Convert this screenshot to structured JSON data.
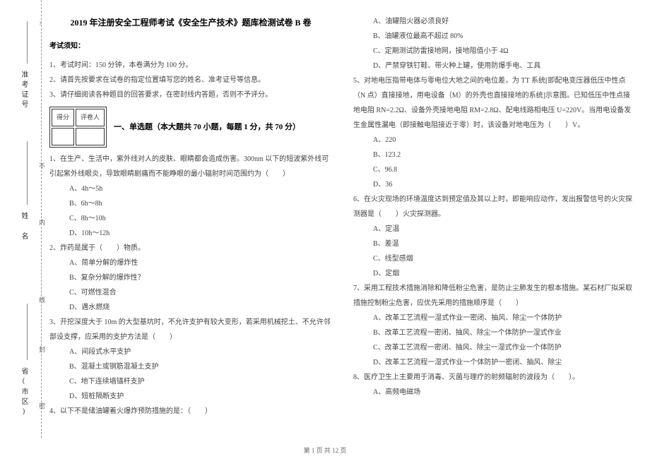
{
  "binding": {
    "labels": [
      "密",
      "封",
      "线",
      "内",
      "不"
    ],
    "fields": [
      "省(市区)",
      "姓 名",
      "准考证号"
    ],
    "top_symbol": "⌢"
  },
  "header": {
    "title": "2019 年注册安全工程师考试《安全生产技术》题库检测试卷 B 卷"
  },
  "notice": {
    "heading": "考试须知：",
    "items": [
      "1、考试时间：150 分钟，本卷满分为 100 分。",
      "2、请首先按要求在试卷的指定位置填写您的姓名、准考证号等信息。",
      "3、请仔细阅读各种题目的回答要求，在密封线内答题，否则不予评分。"
    ]
  },
  "scorebox": {
    "c1": "得分",
    "c2": "评卷人"
  },
  "section1": {
    "title": "一、单选题（本大题共 70 小题，每题 1 分，共 70 分）",
    "q1": {
      "stem": "1、在生产、生活中，紫外线对人的皮肤、眼睛都会造成伤害。300nm 以下的短波紫外线可引起紫外线眼炎，导致眼睛剧痛而不能睁眼的最小辐射时间范围约为（　　）",
      "opts": [
        "A、4h～5h",
        "B、6h～8h",
        "C、8h～10h",
        "D、10h～12h"
      ]
    },
    "q2": {
      "stem": "2、炸药是属于（　　）物质。",
      "opts": [
        "A、简单分解的爆炸性",
        "B、复杂分解的爆炸性？",
        "C、可燃性混合",
        "D、遇水燃烧"
      ]
    },
    "q3": {
      "stem": "3、开挖深度大于 10m 的大型基坑时，不允许支护有较大变形，若采用机械挖土、不允许邻部设支撑，应采用的支护方法是（　　）",
      "opts": [
        "A、间段式水平支护",
        "B、混凝土或钢筋混凝土支护",
        "C、地下连续墙锚杆支护",
        "D、短桩隔断支护"
      ]
    },
    "q4": {
      "stem": "4、以下不是储油罐着火爆炸预防措施的是：（　　）",
      "opts": [
        "A、油罐阻火器必须良好",
        "B、油罐液位最高不超过 80%",
        "C、定期测试防雷接地网，接地阻值小于 4Ω",
        "D、严禁穿铁钉鞋、带火种上罐，使用防爆手电、工具"
      ]
    },
    "q5": {
      "stem": "5、对地电压指带电体与零电位大地之间的电位差，为 TT 系统[即配电变压器低压中性点（N 点）直接接地，用电设备（M）的外壳也直接接地的系统]示意图。已知低压中性点接地电阻 RN=2.2Ω、设备外壳接地电阻 RM=2.8Ω、配电线路相电压 U=220V。当用电设备发生金属性漏电（即接触电阻接近于零）时，该设备对地电压为（　　）V。",
      "opts": [
        "A、220",
        "B、123.2",
        "C、96.8",
        "D、36"
      ]
    },
    "q6": {
      "stem": "6、在火灾现场的环境温度达到预定值及其以上时，即能响应动作，发出报警信号的火灾探测器是（　　）火灾探测器。",
      "opts": [
        "A、定温",
        "B、差温",
        "C、线型感烟",
        "D、定烟"
      ]
    },
    "q7": {
      "stem": "7、采用工程技术措施消除和降低粉尘危害，是防止尘肺发生的根本措施。某石材厂拟采取措施控制粉尘危害，应优先采用的措施顺序是（　　）",
      "opts": [
        "A、改革工艺流程一湿式作业一密闭、抽风、除尘一个体防护",
        "B、改革工艺流程一密闭、抽风、除尘一个体防护一湿式作业",
        "C、改革工艺流程一密闭、抽风、除尘一湿式作业一个体防护",
        "D、改革工艺流程一湿式作业一个体防护一密闭、抽风、除尘"
      ]
    },
    "q8": {
      "stem": "8、医疗卫生上主要用于消毒、灭菌与理疗的射频辐射的波段为（　　）。",
      "opts": [
        "A、高频电磁场"
      ]
    }
  },
  "footer": "第 1 页 共 12 页"
}
